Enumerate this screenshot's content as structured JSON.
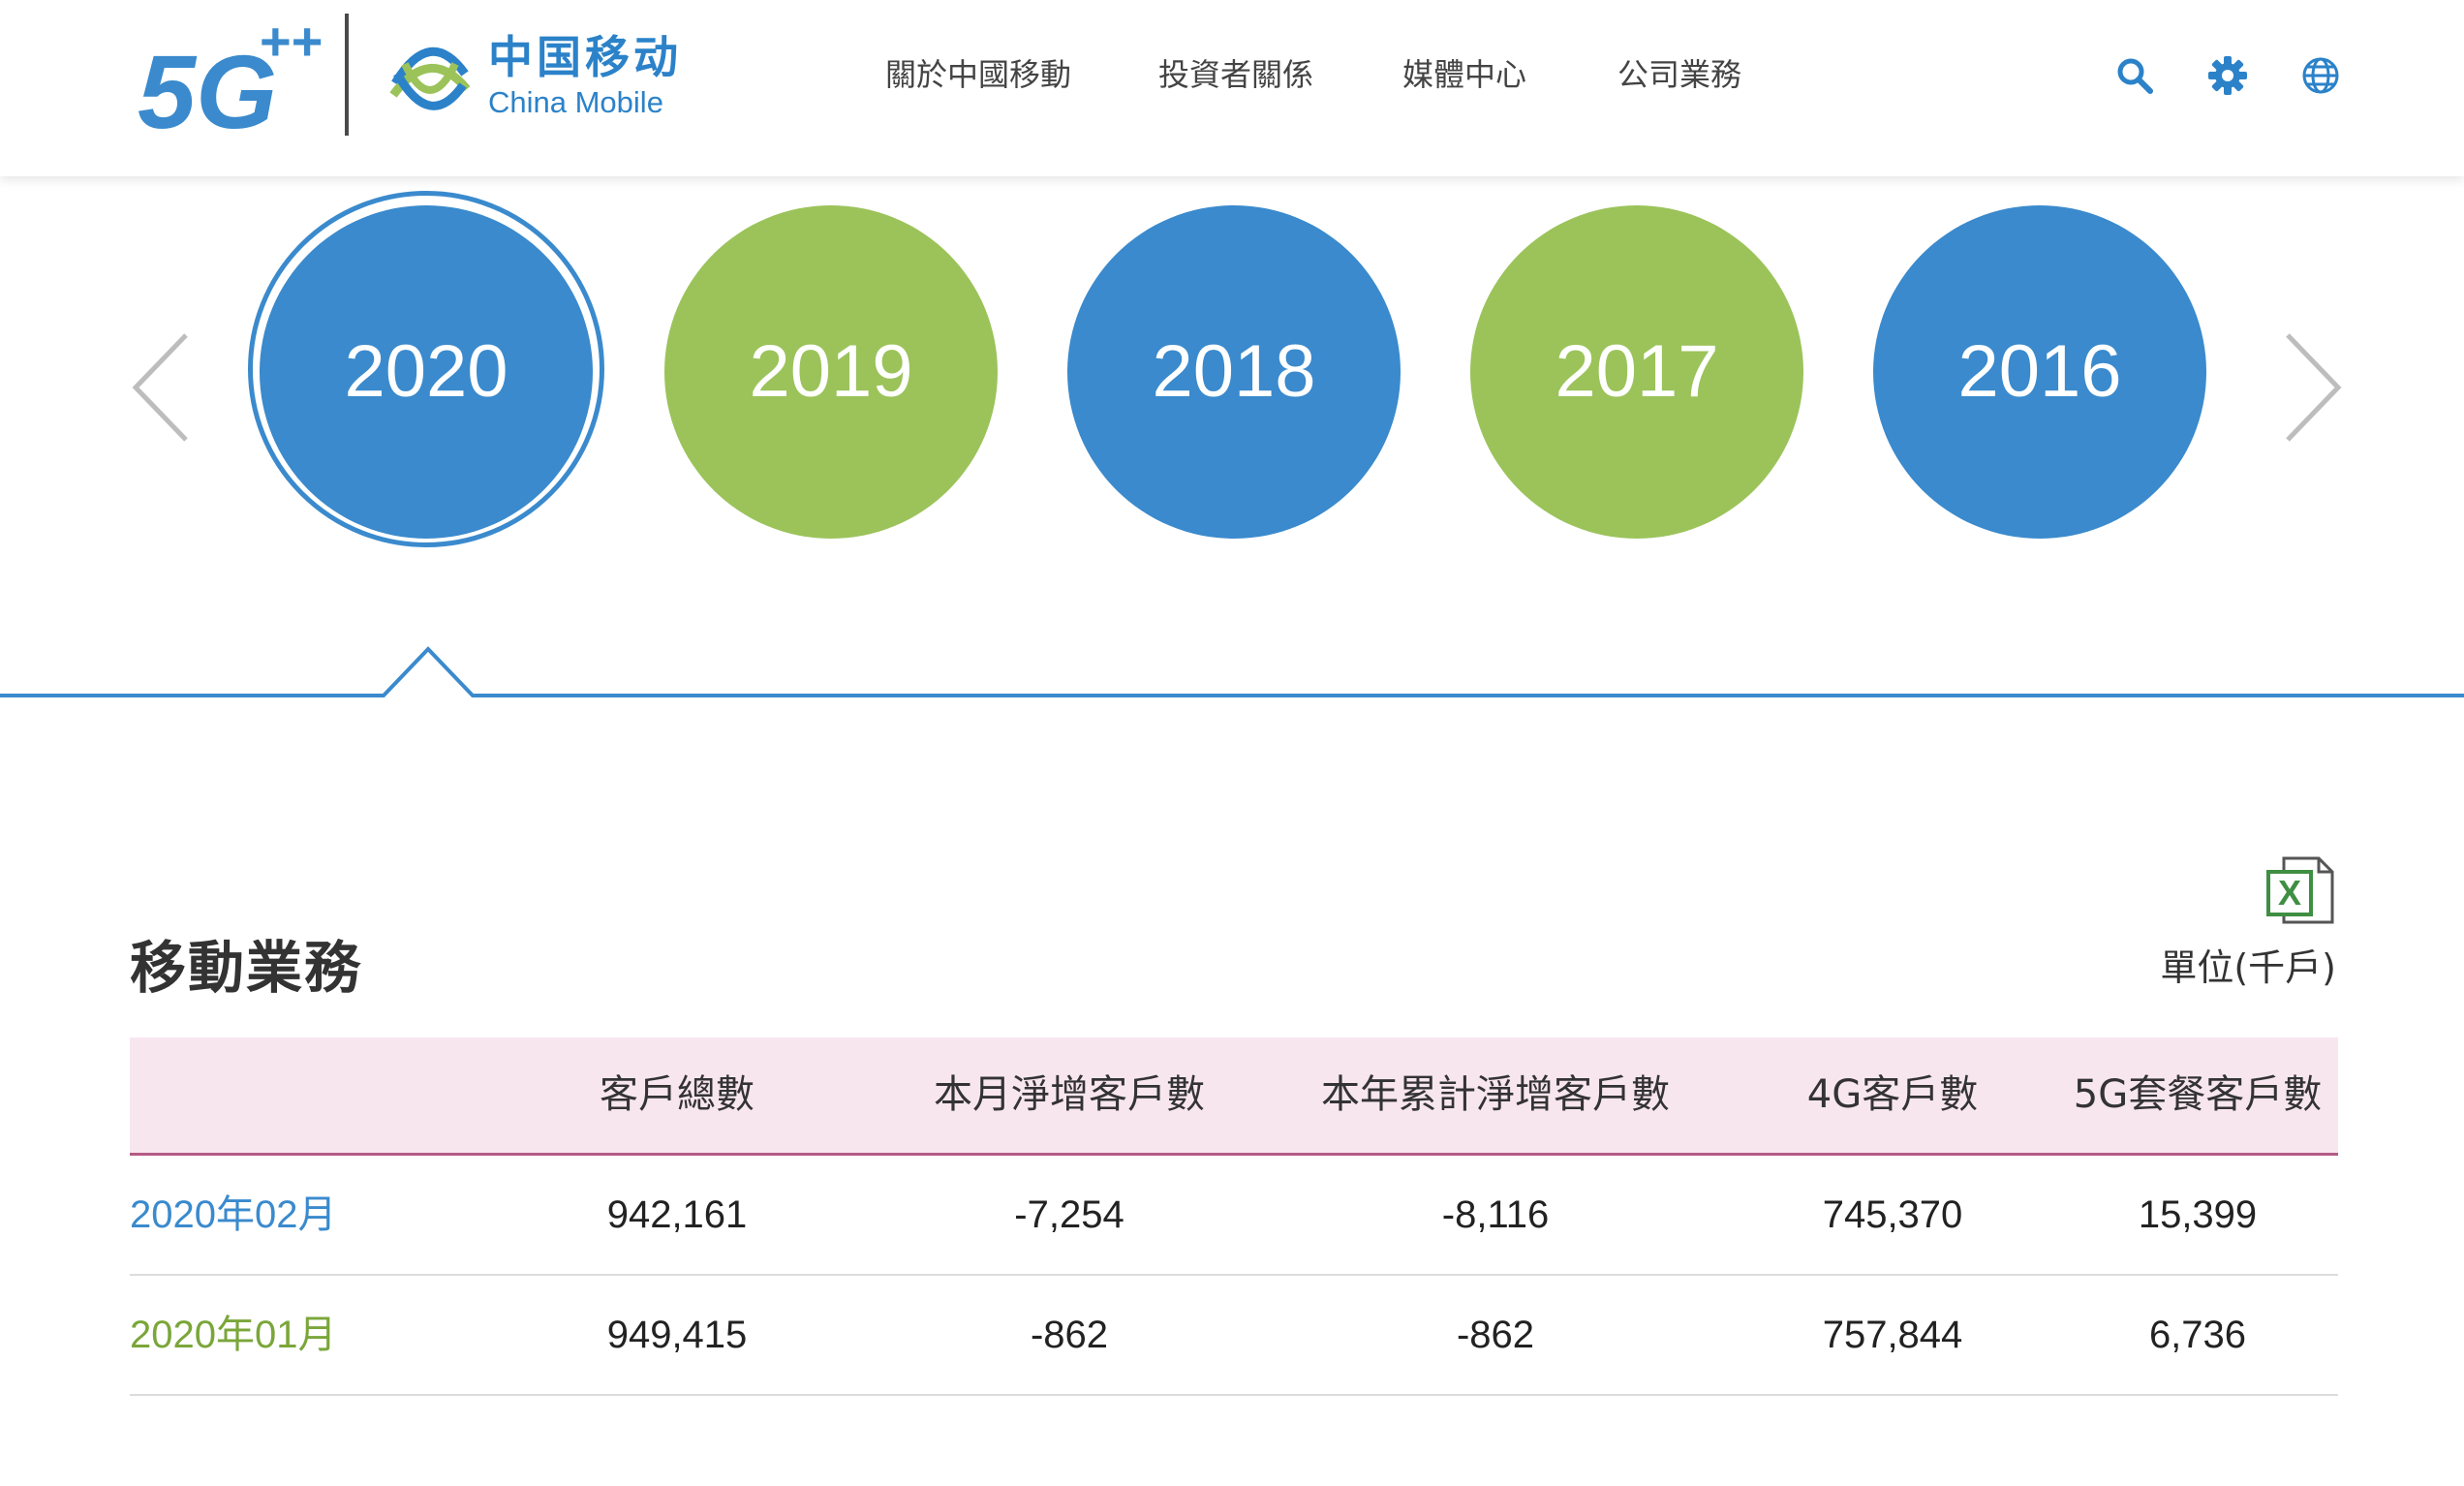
{
  "header": {
    "logo_5g_text": "5G",
    "logo_5g_plus": "++",
    "logo_cn": "中国移动",
    "logo_en": "China Mobile",
    "nav": [
      {
        "label": "關於中國移動"
      },
      {
        "label": "投資者關係"
      },
      {
        "label": "媒體中心"
      },
      {
        "label": "公司業務"
      }
    ],
    "icons": [
      "search-icon",
      "gear-icon",
      "globe-icon"
    ]
  },
  "years": {
    "selected": "2020",
    "items": [
      {
        "label": "2020",
        "color": "blue"
      },
      {
        "label": "2019",
        "color": "green"
      },
      {
        "label": "2018",
        "color": "blue"
      },
      {
        "label": "2017",
        "color": "green"
      },
      {
        "label": "2016",
        "color": "blue"
      }
    ]
  },
  "section": {
    "title": "移動業務",
    "unit": "單位(千戶)",
    "export_icon": "excel-icon"
  },
  "table": {
    "columns": [
      "",
      "客戶總數",
      "本月淨增客戶數",
      "本年累計淨增客戶數",
      "4G客戶數",
      "5G套餐客戶數"
    ],
    "rows": [
      {
        "label": "2020年02月",
        "label_color": "#3a8acd",
        "values": [
          "942,161",
          "-7,254",
          "-8,116",
          "745,370",
          "15,399"
        ]
      },
      {
        "label": "2020年01月",
        "label_color": "#7aa63a",
        "values": [
          "949,415",
          "-862",
          "-862",
          "757,844",
          "6,736"
        ]
      }
    ]
  },
  "colors": {
    "brand_blue": "#3a8acd",
    "brand_green": "#9bc35a",
    "table_header_bg": "#f8e6ef",
    "table_header_rule": "#b55a84"
  }
}
